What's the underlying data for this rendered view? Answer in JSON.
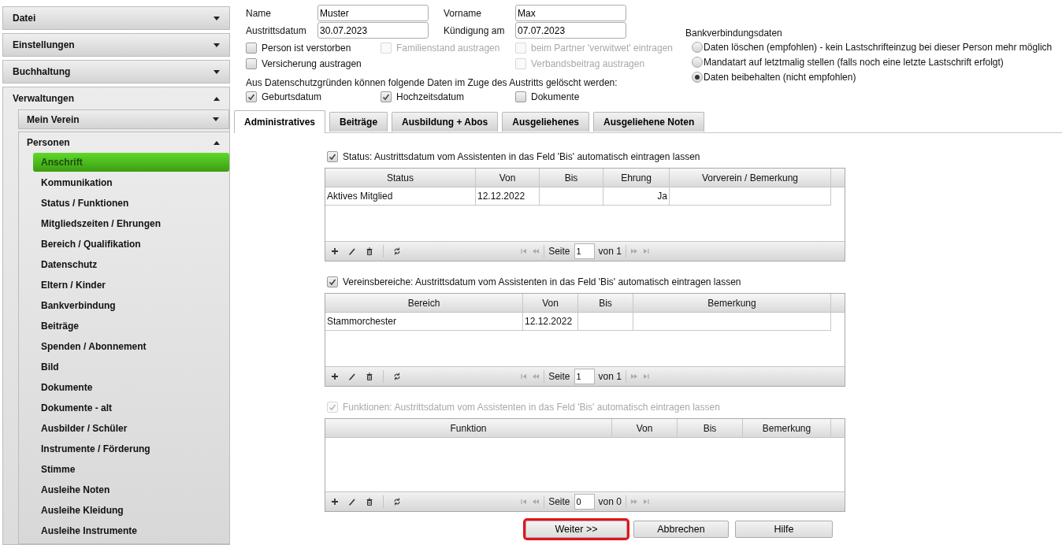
{
  "sidebar": {
    "menus": [
      {
        "label": "Datei",
        "expanded": false
      },
      {
        "label": "Einstellungen",
        "expanded": false
      },
      {
        "label": "Buchhaltung",
        "expanded": false
      },
      {
        "label": "Verwaltungen",
        "expanded": true,
        "children": [
          {
            "label": "Mein Verein",
            "expanded": false
          },
          {
            "label": "Personen",
            "expanded": true,
            "items": [
              {
                "label": "Anschrift",
                "selected": true
              },
              {
                "label": "Kommunikation",
                "selected": false
              },
              {
                "label": "Status / Funktionen",
                "selected": false
              },
              {
                "label": "Mitgliedszeiten / Ehrungen",
                "selected": false
              },
              {
                "label": "Bereich / Qualifikation",
                "selected": false
              },
              {
                "label": "Datenschutz",
                "selected": false
              },
              {
                "label": "Eltern / Kinder",
                "selected": false
              },
              {
                "label": "Bankverbindung",
                "selected": false
              },
              {
                "label": "Beiträge",
                "selected": false
              },
              {
                "label": "Spenden / Abonnement",
                "selected": false
              },
              {
                "label": "Bild",
                "selected": false
              },
              {
                "label": "Dokumente",
                "selected": false
              },
              {
                "label": "Dokumente - alt",
                "selected": false
              },
              {
                "label": "Ausbilder / Schüler",
                "selected": false
              },
              {
                "label": "Instrumente / Förderung",
                "selected": false
              },
              {
                "label": "Stimme",
                "selected": false
              },
              {
                "label": "Ausleihe Noten",
                "selected": false
              },
              {
                "label": "Ausleihe Kleidung",
                "selected": false
              },
              {
                "label": "Ausleihe Instrumente",
                "selected": false
              }
            ]
          }
        ]
      }
    ]
  },
  "form": {
    "fields": [
      {
        "label": "Name",
        "value": "Muster"
      },
      {
        "label": "Vorname",
        "value": "Max"
      },
      {
        "label": "Austrittsdatum",
        "value": "30.07.2023"
      },
      {
        "label": "Kündigung am",
        "value": "07.07.2023"
      }
    ],
    "option_columns": [
      [
        {
          "label": "Person ist verstorben",
          "checked": false,
          "disabled": false
        },
        {
          "label": "Versicherung austragen",
          "checked": false,
          "disabled": false
        }
      ],
      [
        {
          "label": "Familienstand austragen",
          "checked": false,
          "disabled": true
        }
      ],
      [
        {
          "label": "beim Partner 'verwitwet' eintragen",
          "checked": false,
          "disabled": true
        },
        {
          "label": "Verbandsbeitrag austragen",
          "checked": false,
          "disabled": true
        }
      ]
    ],
    "privacy_note": "Aus Datenschutzgründen können folgende Daten im Zuge des Austritts gelöscht werden:",
    "privacy_options": [
      {
        "label": "Geburtsdatum",
        "checked": true,
        "disabled": false
      },
      {
        "label": "Hochzeitsdatum",
        "checked": true,
        "disabled": false
      },
      {
        "label": "Dokumente",
        "checked": false,
        "disabled": false
      }
    ]
  },
  "bank": {
    "title": "Bankverbindungsdaten",
    "options": [
      {
        "label": "Daten löschen (empfohlen) - kein Lastschrifteinzug bei dieser Person mehr möglich",
        "selected": false
      },
      {
        "label": "Mandatart auf letztmalig stellen (falls noch eine letzte Lastschrift erfolgt)",
        "selected": false
      },
      {
        "label": "Daten beibehalten (nicht empfohlen)",
        "selected": true
      }
    ]
  },
  "tabs": [
    {
      "label": "Administratives",
      "selected": true
    },
    {
      "label": "Beiträge",
      "selected": false
    },
    {
      "label": "Ausbildung + Abos",
      "selected": false
    },
    {
      "label": "Ausgeliehenes",
      "selected": false
    },
    {
      "label": "Ausgeliehene Noten",
      "selected": false
    }
  ],
  "sections": [
    {
      "checkbox": {
        "label": "Status: Austrittsdatum vom Assistenten in das Feld 'Bis' automatisch eintragen lassen",
        "checked": true,
        "disabled": false
      },
      "table": {
        "columns": [
          "Status",
          "Von",
          "Bis",
          "Ehrung",
          "Vorverein / Bemerkung"
        ],
        "rows": [
          [
            "Aktives Mitglied",
            "12.12.2022",
            null,
            "Ja",
            null
          ]
        ],
        "pager": {
          "label": "Seite",
          "page": "1",
          "total": "von 1"
        }
      }
    },
    {
      "checkbox": {
        "label": "Vereinsbereiche: Austrittsdatum vom Assistenten in das Feld 'Bis' automatisch eintragen lassen",
        "checked": true,
        "disabled": false
      },
      "table": {
        "columns": [
          "Bereich",
          "Von",
          "Bis",
          "Bemerkung"
        ],
        "rows": [
          [
            "Stammorchester",
            "12.12.2022",
            null,
            null
          ]
        ],
        "pager": {
          "label": "Seite",
          "page": "1",
          "total": "von 1"
        }
      }
    },
    {
      "checkbox": {
        "label": "Funktionen: Austrittsdatum vom Assistenten in das Feld 'Bis' automatisch eintragen lassen",
        "checked": true,
        "disabled": true
      },
      "table": {
        "columns": [
          "Funktion",
          "Von",
          "Bis",
          "Bemerkung"
        ],
        "pager": {
          "label": "Seite",
          "page": "0",
          "total": "von 0"
        }
      }
    }
  ],
  "buttons": [
    {
      "label": "Weiter >>",
      "highlighted": true
    },
    {
      "label": "Abbrechen",
      "highlighted": false
    },
    {
      "label": "Hilfe",
      "highlighted": false
    }
  ]
}
